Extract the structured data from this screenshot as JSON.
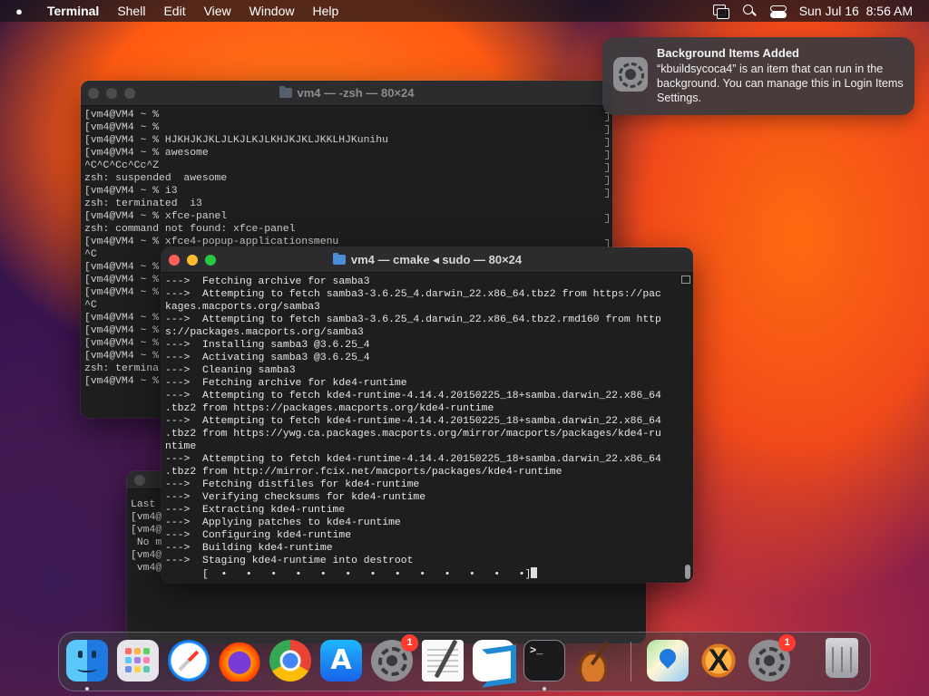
{
  "menubar": {
    "app_name": "Terminal",
    "items": [
      "Shell",
      "Edit",
      "View",
      "Window",
      "Help"
    ],
    "datetime": "Sun Jul 16  8:56 AM"
  },
  "notification": {
    "title": "Background Items Added",
    "body": "“kbuildsycoca4” is an item that can run in the background. You can manage this in Login Items Settings."
  },
  "back_window": {
    "title": "vm4 — -zsh — 80×24",
    "lines": [
      "[vm4@VM4 ~ %",
      "[vm4@VM4 ~ %",
      "[vm4@VM4 ~ % HJKHJKJKLJLKJLKJLKHJKJKLJKKLHJKunihu",
      "[vm4@VM4 ~ % awesome",
      "^C^C^Cc^Cc^Z",
      "zsh: suspended  awesome",
      "[vm4@VM4 ~ % i3",
      "zsh: terminated  i3",
      "[vm4@VM4 ~ % xfce-panel",
      "zsh: command not found: xfce-panel",
      "[vm4@VM4 ~ % xfce4-popup-applicationsmenu",
      "^C",
      "[vm4@VM4 ~ %",
      "[vm4@VM4 ~ %",
      "[vm4@VM4 ~ %",
      "^C",
      "[vm4@VM4 ~ %",
      "[vm4@VM4 ~ %",
      "[vm4@VM4 ~ %",
      "[vm4@VM4 ~ %",
      "zsh: termina",
      "[vm4@VM4 ~ %"
    ]
  },
  "lower_window": {
    "lines": [
      "Last",
      "[vm4@V",
      "[vm4@V",
      " No ma",
      "[vm4@V",
      " vm4@V"
    ]
  },
  "front_window": {
    "title": "vm4 — cmake ◂ sudo — 80×24",
    "lines": [
      "--->  Fetching archive for samba3",
      "--->  Attempting to fetch samba3-3.6.25_4.darwin_22.x86_64.tbz2 from https://pac",
      "kages.macports.org/samba3",
      "--->  Attempting to fetch samba3-3.6.25_4.darwin_22.x86_64.tbz2.rmd160 from http",
      "s://packages.macports.org/samba3",
      "--->  Installing samba3 @3.6.25_4",
      "--->  Activating samba3 @3.6.25_4",
      "--->  Cleaning samba3",
      "--->  Fetching archive for kde4-runtime",
      "--->  Attempting to fetch kde4-runtime-4.14.4.20150225_18+samba.darwin_22.x86_64",
      ".tbz2 from https://packages.macports.org/kde4-runtime",
      "--->  Attempting to fetch kde4-runtime-4.14.4.20150225_18+samba.darwin_22.x86_64",
      ".tbz2 from https://ywg.ca.packages.macports.org/mirror/macports/packages/kde4-ru",
      "ntime",
      "--->  Attempting to fetch kde4-runtime-4.14.4.20150225_18+samba.darwin_22.x86_64",
      ".tbz2 from http://mirror.fcix.net/macports/packages/kde4-runtime",
      "--->  Fetching distfiles for kde4-runtime",
      "--->  Verifying checksums for kde4-runtime",
      "--->  Extracting kde4-runtime",
      "--->  Applying patches to kde4-runtime",
      "--->  Configuring kde4-runtime",
      "--->  Building kde4-runtime",
      "--->  Staging kde4-runtime into destroot"
    ],
    "progress_line": "      [  •   •   •   •   •   •   •   •   •   •   •   •   •]"
  },
  "dock": {
    "apps": [
      {
        "name": "finder-icon"
      },
      {
        "name": "launchpad-icon"
      },
      {
        "name": "safari-icon"
      },
      {
        "name": "firefox-icon"
      },
      {
        "name": "chrome-icon"
      },
      {
        "name": "app-store-icon"
      },
      {
        "name": "system-settings-icon",
        "badge": "1"
      },
      {
        "name": "textedit-icon"
      },
      {
        "name": "vscode-icon"
      },
      {
        "name": "terminal-icon"
      },
      {
        "name": "garageband-icon"
      },
      {
        "name": "maps-icon"
      },
      {
        "name": "xquartz-icon"
      },
      {
        "name": "system-settings-icon",
        "badge": "1"
      },
      {
        "name": "trash-icon"
      }
    ]
  }
}
